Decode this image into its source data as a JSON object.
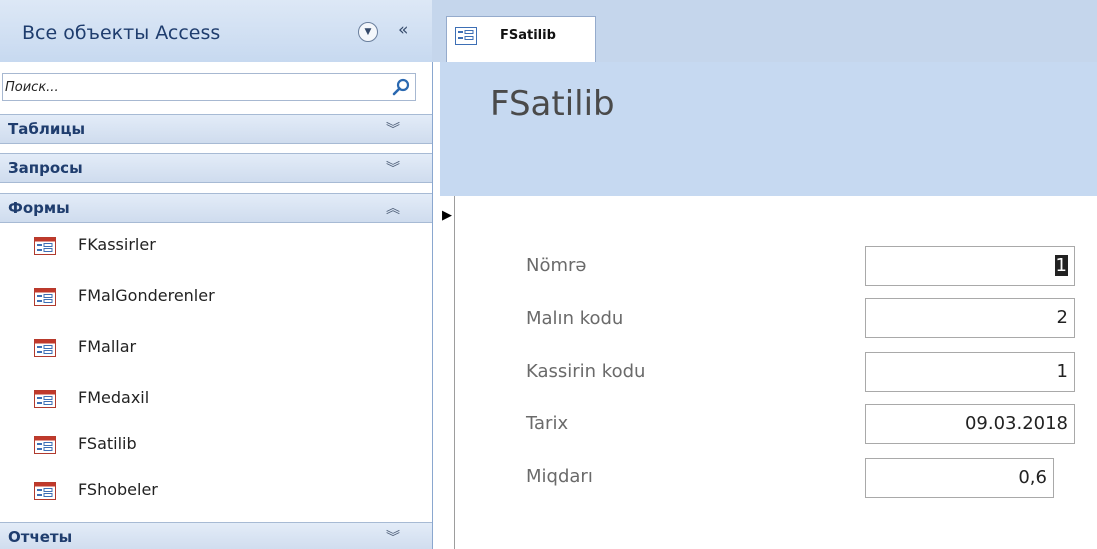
{
  "nav_pane": {
    "title": "Все объекты Access",
    "dropdown_icon": "chevron-down-circle-icon",
    "collapse_icon": "double-chevron-left-icon",
    "collapse_glyph": "«",
    "search": {
      "placeholder": "Поиск...",
      "icon": "search-icon"
    },
    "groups": [
      {
        "label": "Таблицы",
        "state": "collapsed",
        "chevron": "»"
      },
      {
        "label": "Запросы",
        "state": "collapsed",
        "chevron": "»"
      },
      {
        "label": "Формы",
        "state": "expanded",
        "chevron": "«",
        "items": [
          {
            "label": "FKassirler",
            "icon": "form-icon"
          },
          {
            "label": "FMalGonderenler",
            "icon": "form-icon"
          },
          {
            "label": "FMallar",
            "icon": "form-icon"
          },
          {
            "label": "FMedaxil",
            "icon": "form-icon"
          },
          {
            "label": "FSatilib",
            "icon": "form-icon"
          },
          {
            "label": "FShobeler",
            "icon": "form-icon"
          }
        ]
      },
      {
        "label": "Отчеты",
        "state": "collapsed",
        "chevron": "»"
      }
    ]
  },
  "document_tab": {
    "label": "FSatilib",
    "icon": "form-icon"
  },
  "form": {
    "title": "FSatilib",
    "record_selector_glyph": "▶",
    "fields": [
      {
        "label": "Nömrə",
        "value": "1"
      },
      {
        "label": "Malın kodu",
        "value": "2"
      },
      {
        "label": "Kassirin kodu",
        "value": "1"
      },
      {
        "label": "Tarix",
        "value": "09.03.2018"
      },
      {
        "label": "Miqdarı",
        "value": "0,6"
      }
    ]
  },
  "colors": {
    "nav_title": "#1f3d6e",
    "header_band": "#c6d9f1",
    "group_header": "#d6e2f2",
    "form_icon_red": "#c0392b",
    "form_icon_blue": "#3d6fb5"
  }
}
